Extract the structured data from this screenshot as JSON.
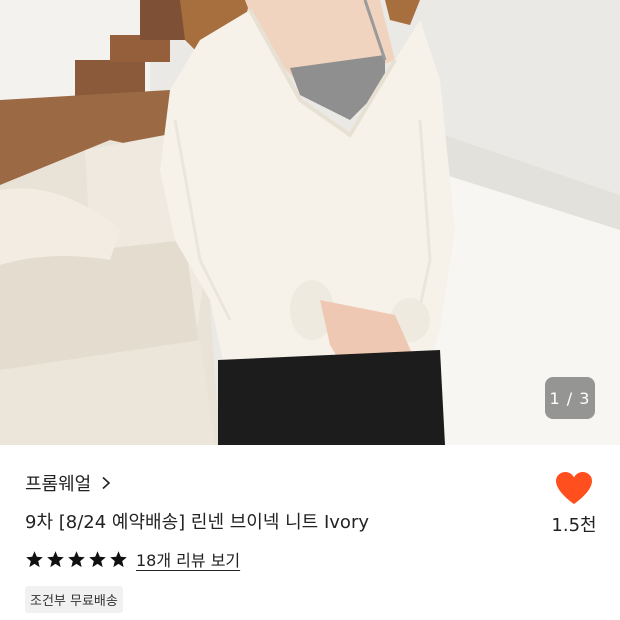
{
  "gallery": {
    "current_page": 1,
    "total_pages": 3,
    "indicator": "1 / 3"
  },
  "product": {
    "brand": "프롬웨얼",
    "title": "9차 [8/24 예약배송] 린넨 브이넥 니트 Ivory",
    "rating_stars": 5,
    "review_link": "18개 리뷰 보기",
    "shipping_badge": "조건부 무료배송"
  },
  "like": {
    "count": "1.5천",
    "color": "#ff4f1f"
  },
  "icons": [
    "chevron-right-icon",
    "star-icon",
    "heart-icon"
  ]
}
